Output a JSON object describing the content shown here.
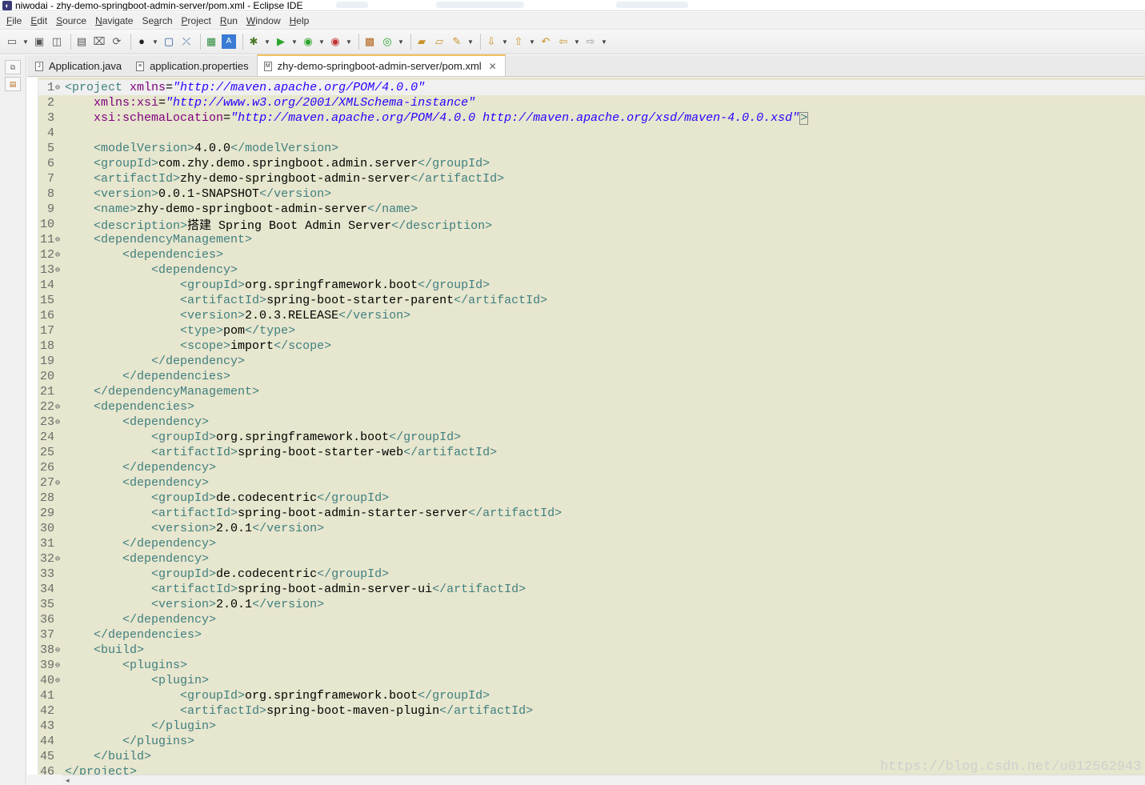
{
  "window": {
    "title": "niwodai - zhy-demo-springboot-admin-server/pom.xml - Eclipse IDE"
  },
  "menu": {
    "items": [
      {
        "label": "File",
        "mnemonic": "F",
        "rest": "ile"
      },
      {
        "label": "Edit",
        "mnemonic": "E",
        "rest": "dit"
      },
      {
        "label": "Source",
        "mnemonic": "S",
        "rest": "ource"
      },
      {
        "label": "Navigate",
        "mnemonic": "N",
        "rest": "avigate"
      },
      {
        "label": "Search",
        "mnemonic": "a",
        "prefix": "Se",
        "rest": "rch"
      },
      {
        "label": "Project",
        "mnemonic": "P",
        "rest": "roject"
      },
      {
        "label": "Run",
        "mnemonic": "R",
        "rest": "un"
      },
      {
        "label": "Window",
        "mnemonic": "W",
        "rest": "indow"
      },
      {
        "label": "Help",
        "mnemonic": "H",
        "rest": "elp"
      }
    ]
  },
  "toolbar": {
    "icons": [
      "new-wizard-icon",
      "save-icon",
      "save-all-icon",
      "binary-icon",
      "build-icon",
      "refresh-icon",
      "profile-icon",
      "terminal-icon",
      "breakpoint-icon",
      "open-type-icon",
      "ant-icon",
      "debug-icon",
      "run-icon",
      "coverage-icon",
      "external-tools-icon",
      "new-package-icon",
      "new-class-icon",
      "open-folder-icon",
      "open-resource-icon",
      "search-icon",
      "next-annotation-icon",
      "prev-annotation-icon",
      "last-edit-icon",
      "back-icon",
      "forward-icon"
    ]
  },
  "tabs": [
    {
      "label": "Application.java",
      "icon": "java-file-icon",
      "active": false
    },
    {
      "label": "application.properties",
      "icon": "properties-file-icon",
      "active": false
    },
    {
      "label": "zhy-demo-springboot-admin-server/pom.xml",
      "icon": "maven-pom-icon",
      "active": true
    }
  ],
  "close_glyph": "✕",
  "editor": {
    "lines": [
      {
        "n": "1",
        "fold": true,
        "indent": 0,
        "segs": [
          [
            "tag",
            "<project "
          ],
          [
            "attr",
            "xmlns"
          ],
          [
            "txt",
            "="
          ],
          [
            "str",
            "\"http://maven.apache.org/POM/4.0.0\""
          ]
        ]
      },
      {
        "n": "2",
        "fold": false,
        "indent": 4,
        "segs": [
          [
            "attr",
            "xmlns:xsi"
          ],
          [
            "txt",
            "="
          ],
          [
            "str",
            "\"http://www.w3.org/2001/XMLSchema-instance\""
          ]
        ]
      },
      {
        "n": "3",
        "fold": false,
        "indent": 4,
        "segs": [
          [
            "attr",
            "xsi:schemaLocation"
          ],
          [
            "txt",
            "="
          ],
          [
            "str",
            "\"http://maven.apache.org/POM/4.0.0 http://maven.apache.org/xsd/maven-4.0.0.xsd\""
          ],
          [
            "box",
            ">"
          ]
        ]
      },
      {
        "n": "4",
        "fold": false,
        "indent": 0,
        "segs": []
      },
      {
        "n": "5",
        "fold": false,
        "indent": 4,
        "segs": [
          [
            "tag",
            "<modelVersion>"
          ],
          [
            "txt",
            "4.0.0"
          ],
          [
            "tag",
            "</modelVersion>"
          ]
        ]
      },
      {
        "n": "6",
        "fold": false,
        "indent": 4,
        "segs": [
          [
            "tag",
            "<groupId>"
          ],
          [
            "txt",
            "com.zhy.demo.springboot.admin.server"
          ],
          [
            "tag",
            "</groupId>"
          ]
        ]
      },
      {
        "n": "7",
        "fold": false,
        "indent": 4,
        "segs": [
          [
            "tag",
            "<artifactId>"
          ],
          [
            "txt",
            "zhy-demo-springboot-admin-server"
          ],
          [
            "tag",
            "</artifactId>"
          ]
        ]
      },
      {
        "n": "8",
        "fold": false,
        "indent": 4,
        "segs": [
          [
            "tag",
            "<version>"
          ],
          [
            "txt",
            "0.0.1-SNAPSHOT"
          ],
          [
            "tag",
            "</version>"
          ]
        ]
      },
      {
        "n": "9",
        "fold": false,
        "indent": 4,
        "segs": [
          [
            "tag",
            "<name>"
          ],
          [
            "txt",
            "zhy-demo-springboot-admin-server"
          ],
          [
            "tag",
            "</name>"
          ]
        ]
      },
      {
        "n": "10",
        "fold": false,
        "indent": 4,
        "segs": [
          [
            "tag",
            "<description>"
          ],
          [
            "txt",
            "搭建 Spring Boot Admin Server"
          ],
          [
            "tag",
            "</description>"
          ]
        ]
      },
      {
        "n": "11",
        "fold": true,
        "indent": 4,
        "segs": [
          [
            "tag",
            "<dependencyManagement>"
          ]
        ]
      },
      {
        "n": "12",
        "fold": true,
        "indent": 8,
        "segs": [
          [
            "tag",
            "<dependencies>"
          ]
        ]
      },
      {
        "n": "13",
        "fold": true,
        "indent": 12,
        "segs": [
          [
            "tag",
            "<dependency>"
          ]
        ]
      },
      {
        "n": "14",
        "fold": false,
        "indent": 16,
        "segs": [
          [
            "tag",
            "<groupId>"
          ],
          [
            "txt",
            "org.springframework.boot"
          ],
          [
            "tag",
            "</groupId>"
          ]
        ]
      },
      {
        "n": "15",
        "fold": false,
        "indent": 16,
        "segs": [
          [
            "tag",
            "<artifactId>"
          ],
          [
            "txt",
            "spring-boot-starter-parent"
          ],
          [
            "tag",
            "</artifactId>"
          ]
        ]
      },
      {
        "n": "16",
        "fold": false,
        "indent": 16,
        "segs": [
          [
            "tag",
            "<version>"
          ],
          [
            "txt",
            "2.0.3.RELEASE"
          ],
          [
            "tag",
            "</version>"
          ]
        ]
      },
      {
        "n": "17",
        "fold": false,
        "indent": 16,
        "segs": [
          [
            "tag",
            "<type>"
          ],
          [
            "txt",
            "pom"
          ],
          [
            "tag",
            "</type>"
          ]
        ]
      },
      {
        "n": "18",
        "fold": false,
        "indent": 16,
        "segs": [
          [
            "tag",
            "<scope>"
          ],
          [
            "txt",
            "import"
          ],
          [
            "tag",
            "</scope>"
          ]
        ]
      },
      {
        "n": "19",
        "fold": false,
        "indent": 12,
        "segs": [
          [
            "tag",
            "</dependency>"
          ]
        ]
      },
      {
        "n": "20",
        "fold": false,
        "indent": 8,
        "segs": [
          [
            "tag",
            "</dependencies>"
          ]
        ]
      },
      {
        "n": "21",
        "fold": false,
        "indent": 4,
        "segs": [
          [
            "tag",
            "</dependencyManagement>"
          ]
        ]
      },
      {
        "n": "22",
        "fold": true,
        "indent": 4,
        "segs": [
          [
            "tag",
            "<dependencies>"
          ]
        ]
      },
      {
        "n": "23",
        "fold": true,
        "indent": 8,
        "segs": [
          [
            "tag",
            "<dependency>"
          ]
        ]
      },
      {
        "n": "24",
        "fold": false,
        "indent": 12,
        "segs": [
          [
            "tag",
            "<groupId>"
          ],
          [
            "txt",
            "org.springframework.boot"
          ],
          [
            "tag",
            "</groupId>"
          ]
        ]
      },
      {
        "n": "25",
        "fold": false,
        "indent": 12,
        "segs": [
          [
            "tag",
            "<artifactId>"
          ],
          [
            "txt",
            "spring-boot-starter-web"
          ],
          [
            "tag",
            "</artifactId>"
          ]
        ]
      },
      {
        "n": "26",
        "fold": false,
        "indent": 8,
        "segs": [
          [
            "tag",
            "</dependency>"
          ]
        ]
      },
      {
        "n": "27",
        "fold": true,
        "indent": 8,
        "segs": [
          [
            "tag",
            "<dependency>"
          ]
        ]
      },
      {
        "n": "28",
        "fold": false,
        "indent": 12,
        "segs": [
          [
            "tag",
            "<groupId>"
          ],
          [
            "txt",
            "de.codecentric"
          ],
          [
            "tag",
            "</groupId>"
          ]
        ]
      },
      {
        "n": "29",
        "fold": false,
        "indent": 12,
        "segs": [
          [
            "tag",
            "<artifactId>"
          ],
          [
            "txt",
            "spring-boot-admin-starter-server"
          ],
          [
            "tag",
            "</artifactId>"
          ]
        ]
      },
      {
        "n": "30",
        "fold": false,
        "indent": 12,
        "segs": [
          [
            "tag",
            "<version>"
          ],
          [
            "txt",
            "2.0.1"
          ],
          [
            "tag",
            "</version>"
          ]
        ]
      },
      {
        "n": "31",
        "fold": false,
        "indent": 8,
        "segs": [
          [
            "tag",
            "</dependency>"
          ]
        ]
      },
      {
        "n": "32",
        "fold": true,
        "indent": 8,
        "segs": [
          [
            "tag",
            "<dependency>"
          ]
        ]
      },
      {
        "n": "33",
        "fold": false,
        "indent": 12,
        "segs": [
          [
            "tag",
            "<groupId>"
          ],
          [
            "txt",
            "de.codecentric"
          ],
          [
            "tag",
            "</groupId>"
          ]
        ]
      },
      {
        "n": "34",
        "fold": false,
        "indent": 12,
        "segs": [
          [
            "tag",
            "<artifactId>"
          ],
          [
            "txt",
            "spring-boot-admin-server-ui"
          ],
          [
            "tag",
            "</artifactId>"
          ]
        ]
      },
      {
        "n": "35",
        "fold": false,
        "indent": 12,
        "segs": [
          [
            "tag",
            "<version>"
          ],
          [
            "txt",
            "2.0.1"
          ],
          [
            "tag",
            "</version>"
          ]
        ]
      },
      {
        "n": "36",
        "fold": false,
        "indent": 8,
        "segs": [
          [
            "tag",
            "</dependency>"
          ]
        ]
      },
      {
        "n": "37",
        "fold": false,
        "indent": 4,
        "segs": [
          [
            "tag",
            "</dependencies>"
          ]
        ]
      },
      {
        "n": "38",
        "fold": true,
        "indent": 4,
        "segs": [
          [
            "tag",
            "<build>"
          ]
        ]
      },
      {
        "n": "39",
        "fold": true,
        "indent": 8,
        "segs": [
          [
            "tag",
            "<plugins>"
          ]
        ]
      },
      {
        "n": "40",
        "fold": true,
        "indent": 12,
        "segs": [
          [
            "tag",
            "<plugin>"
          ]
        ]
      },
      {
        "n": "41",
        "fold": false,
        "indent": 16,
        "segs": [
          [
            "tag",
            "<groupId>"
          ],
          [
            "txt",
            "org.springframework.boot"
          ],
          [
            "tag",
            "</groupId>"
          ]
        ]
      },
      {
        "n": "42",
        "fold": false,
        "indent": 16,
        "segs": [
          [
            "tag",
            "<artifactId>"
          ],
          [
            "txt",
            "spring-boot-maven-plugin"
          ],
          [
            "tag",
            "</artifactId>"
          ]
        ]
      },
      {
        "n": "43",
        "fold": false,
        "indent": 12,
        "segs": [
          [
            "tag",
            "</plugin>"
          ]
        ]
      },
      {
        "n": "44",
        "fold": false,
        "indent": 8,
        "segs": [
          [
            "tag",
            "</plugins>"
          ]
        ]
      },
      {
        "n": "45",
        "fold": false,
        "indent": 4,
        "segs": [
          [
            "tag",
            "</build>"
          ]
        ]
      },
      {
        "n": "46",
        "fold": false,
        "indent": 0,
        "segs": [
          [
            "tag",
            "</project>"
          ]
        ]
      }
    ]
  },
  "watermark": "https://blog.csdn.net/u012562943",
  "colors": {
    "editor_bg": "#e7e6ce",
    "tag": "#3f7f7f",
    "attribute": "#7f007f",
    "string": "#2a00ff",
    "active_tab_accent": "#f3c25c"
  }
}
